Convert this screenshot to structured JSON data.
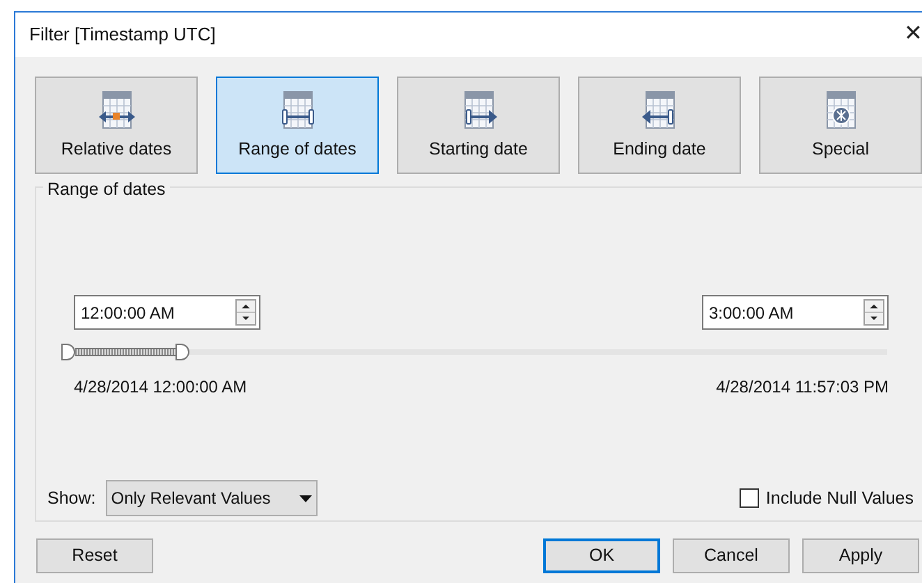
{
  "window": {
    "title": "Filter [Timestamp UTC]",
    "close": "✕"
  },
  "modes": [
    {
      "label": "Relative dates",
      "kind": "relative",
      "selected": false
    },
    {
      "label": "Range of dates",
      "kind": "range",
      "selected": true
    },
    {
      "label": "Starting date",
      "kind": "start",
      "selected": false
    },
    {
      "label": "Ending date",
      "kind": "end",
      "selected": false
    },
    {
      "label": "Special",
      "kind": "special",
      "selected": false
    }
  ],
  "group": {
    "title": "Range of dates",
    "start_time": "12:00:00 AM",
    "end_time": "3:00:00 AM",
    "slider": {
      "start": {
        "level": 0
      },
      "end": {
        "level": 0.146
      }
    },
    "min_label": "4/28/2014 12:00:00 AM",
    "max_label": "4/28/2014 11:57:03 PM",
    "show_label": "Show:",
    "show_value": "Only Relevant Values",
    "include_null": {
      "label": "Include Null Values",
      "checked": false
    }
  },
  "buttons": [
    {
      "label": "Reset",
      "selected": false
    },
    {
      "label": "OK",
      "selected": true
    },
    {
      "label": "Cancel",
      "selected": false
    },
    {
      "label": "Apply",
      "selected": false
    }
  ]
}
